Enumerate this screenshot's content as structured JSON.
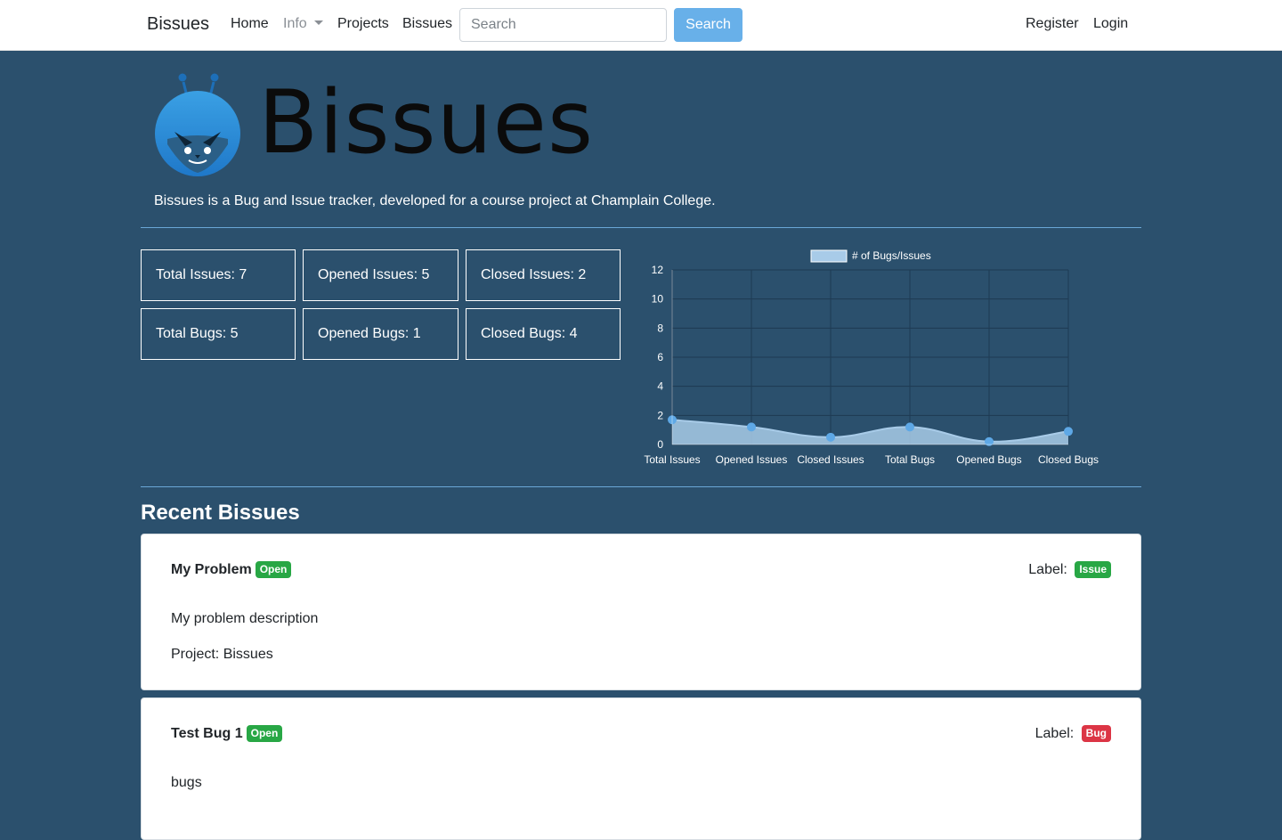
{
  "navbar": {
    "brand": "Bissues",
    "links": {
      "home": "Home",
      "info": "Info",
      "projects": "Projects",
      "bissues": "Bissues"
    },
    "search": {
      "placeholder": "Search",
      "button": "Search"
    },
    "auth": {
      "register": "Register",
      "login": "Login"
    }
  },
  "hero": {
    "logo_text": "Bissues",
    "tagline": "Bissues is a Bug and Issue tracker, developed for a course project at Champlain College."
  },
  "stats": [
    {
      "label": "Total Issues: 7"
    },
    {
      "label": "Opened Issues: 5"
    },
    {
      "label": "Closed Issues: 2"
    },
    {
      "label": "Total Bugs: 5"
    },
    {
      "label": "Opened Bugs: 1"
    },
    {
      "label": "Closed Bugs: 4"
    }
  ],
  "chart_data": {
    "type": "area",
    "categories": [
      "Total Issues",
      "Opened Issues",
      "Closed Issues",
      "Total Bugs",
      "Opened Bugs",
      "Closed Bugs"
    ],
    "series": [
      {
        "name": "# of Bugs/Issues",
        "values": [
          1.7,
          1.2,
          0.5,
          1.2,
          0.2,
          0.9
        ]
      }
    ],
    "y_ticks": [
      0,
      2,
      4,
      6,
      8,
      10,
      12
    ],
    "ylim": [
      0,
      12
    ],
    "grid": true,
    "legend": "top",
    "colors": {
      "fill": "#a8cbe8",
      "point": "#5ea8e6",
      "grid": "#1e3a52"
    }
  },
  "recent": {
    "title": "Recent Bissues",
    "items": [
      {
        "title": "My Problem",
        "status": "Open",
        "label_prefix": "Label:",
        "label": "Issue",
        "description": "My problem description",
        "project": "Project: Bissues"
      },
      {
        "title": "Test Bug 1",
        "status": "Open",
        "label_prefix": "Label:",
        "label": "Bug",
        "description": "bugs",
        "project": ""
      }
    ]
  },
  "colors": {
    "background": "#2b506d",
    "accent": "#68b0e9",
    "badge_green": "#28a745",
    "badge_red": "#dc3545"
  }
}
